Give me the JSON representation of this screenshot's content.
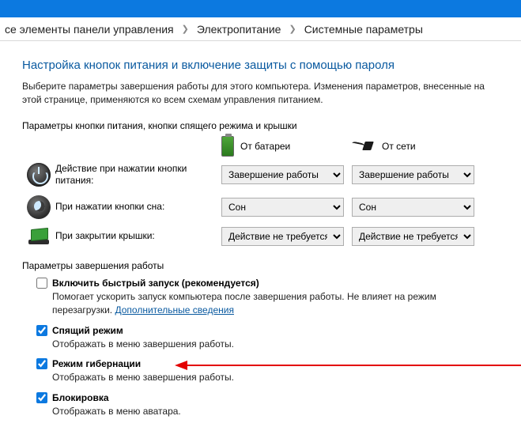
{
  "breadcrumb": {
    "a": "се элементы панели управления",
    "b": "Электропитание",
    "c": "Системные параметры"
  },
  "pageTitle": "Настройка кнопок питания и включение защиты с помощью пароля",
  "pageDesc": "Выберите параметры завершения работы для этого компьютера. Изменения параметров, внесенные на этой странице, применяются ко всем схемам управления питанием.",
  "hwSection": "Параметры кнопки питания, кнопки спящего режима и крышки",
  "cols": {
    "battery": "От батареи",
    "ac": "От сети"
  },
  "rows": {
    "power": {
      "label": "Действие при нажатии кнопки питания:",
      "bat": "Завершение работы",
      "ac": "Завершение работы"
    },
    "sleep": {
      "label": "При нажатии кнопки сна:",
      "bat": "Сон",
      "ac": "Сон"
    },
    "lid": {
      "label": "При закрытии крышки:",
      "bat": "Действие не требуется",
      "ac": "Действие не требуется"
    }
  },
  "sdSection": "Параметры завершения работы",
  "sd": {
    "fast": {
      "title": "Включить быстрый запуск (рекомендуется)",
      "sub1": "Помогает ускорить запуск компьютера после завершения работы. Не влияет на режим перезагрузки. ",
      "link": "Дополнительные сведения"
    },
    "sleep": {
      "title": "Спящий режим",
      "sub": "Отображать в меню завершения работы."
    },
    "hib": {
      "title": "Режим гибернации",
      "sub": "Отображать в меню завершения работы."
    },
    "lock": {
      "title": "Блокировка",
      "sub": "Отображать в меню аватара."
    }
  }
}
